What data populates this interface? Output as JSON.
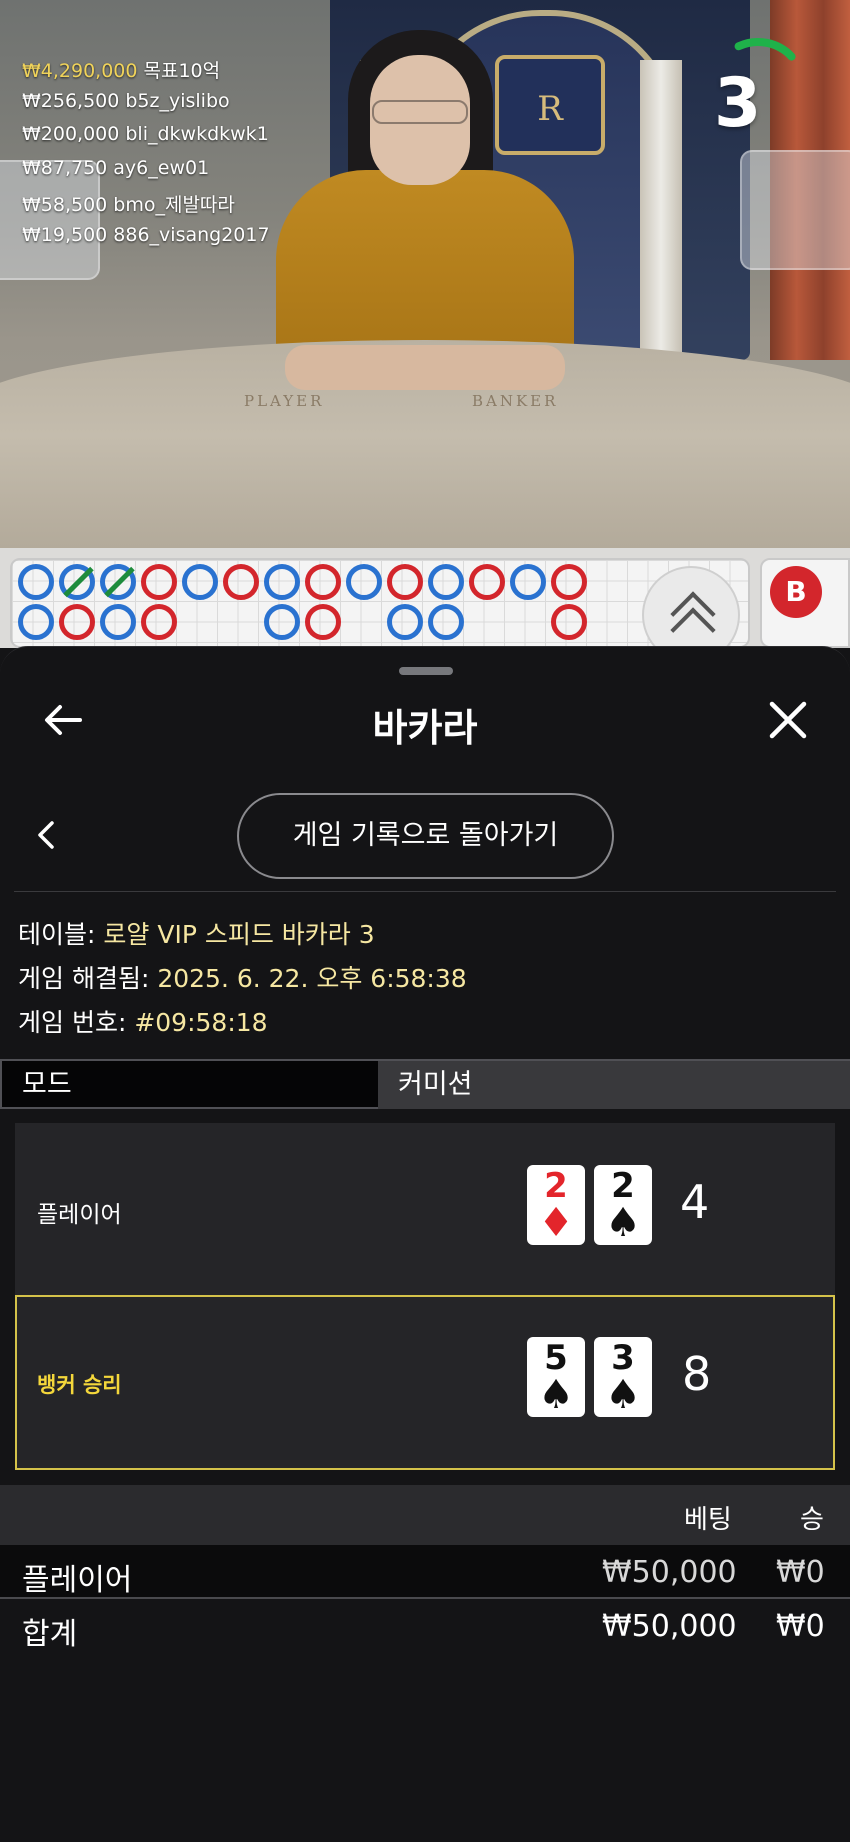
{
  "leaderboard": [
    {
      "amount": "₩4,290,000",
      "name": "목표10억"
    },
    {
      "amount": "₩256,500",
      "name": "b5z_yislibo"
    },
    {
      "amount": "₩200,000",
      "name": "bli_dkwkdkwk1"
    },
    {
      "amount": "₩87,750",
      "name": "ay6_ew01"
    },
    {
      "amount": "₩58,500",
      "name": "bmo_제발따라"
    },
    {
      "amount": "₩19,500",
      "name": "886_visang2017"
    }
  ],
  "countdown": {
    "value": "3",
    "fraction_remaining": 0.2,
    "color": "#1fb24a"
  },
  "table_markings": {
    "player": "PLAYER",
    "banker": "BANKER",
    "crest": "R"
  },
  "road_side": {
    "label": "B"
  },
  "sheet": {
    "title": "바카라",
    "history_button": "게임 기록으로 돌아가기",
    "info": {
      "table_label": "테이블:",
      "table_value": "로얄 VIP 스피드 바카라 3",
      "resolved_label": "게임 해결됨:",
      "resolved_value": "2025. 6. 22. 오후 6:58:38",
      "number_label": "게임 번호:",
      "number_value": "#09:58:18"
    },
    "tabs": [
      {
        "label": "모드"
      },
      {
        "label": "커미션"
      }
    ],
    "player_hand": {
      "label": "플레이어",
      "cards": [
        {
          "rank": "2",
          "suit": "♦",
          "color": "red"
        },
        {
          "rank": "2",
          "suit": "♠",
          "color": "black"
        }
      ],
      "score": "4"
    },
    "banker_hand": {
      "label": "뱅커 승리",
      "cards": [
        {
          "rank": "5",
          "suit": "♠",
          "color": "black"
        },
        {
          "rank": "3",
          "suit": "♠",
          "color": "black"
        }
      ],
      "score": "8"
    },
    "bets": {
      "col_bet": "베팅",
      "col_win": "승",
      "rows": [
        {
          "label": "플레이어",
          "bet": "₩50,000",
          "win": "₩0"
        },
        {
          "label": "합계",
          "bet": "₩50,000",
          "win": "₩0"
        }
      ]
    },
    "accent_colors": {
      "winner_border": "#d4c24a",
      "winner_text": "#f4d73b",
      "info_value": "#f6e7a2"
    }
  }
}
